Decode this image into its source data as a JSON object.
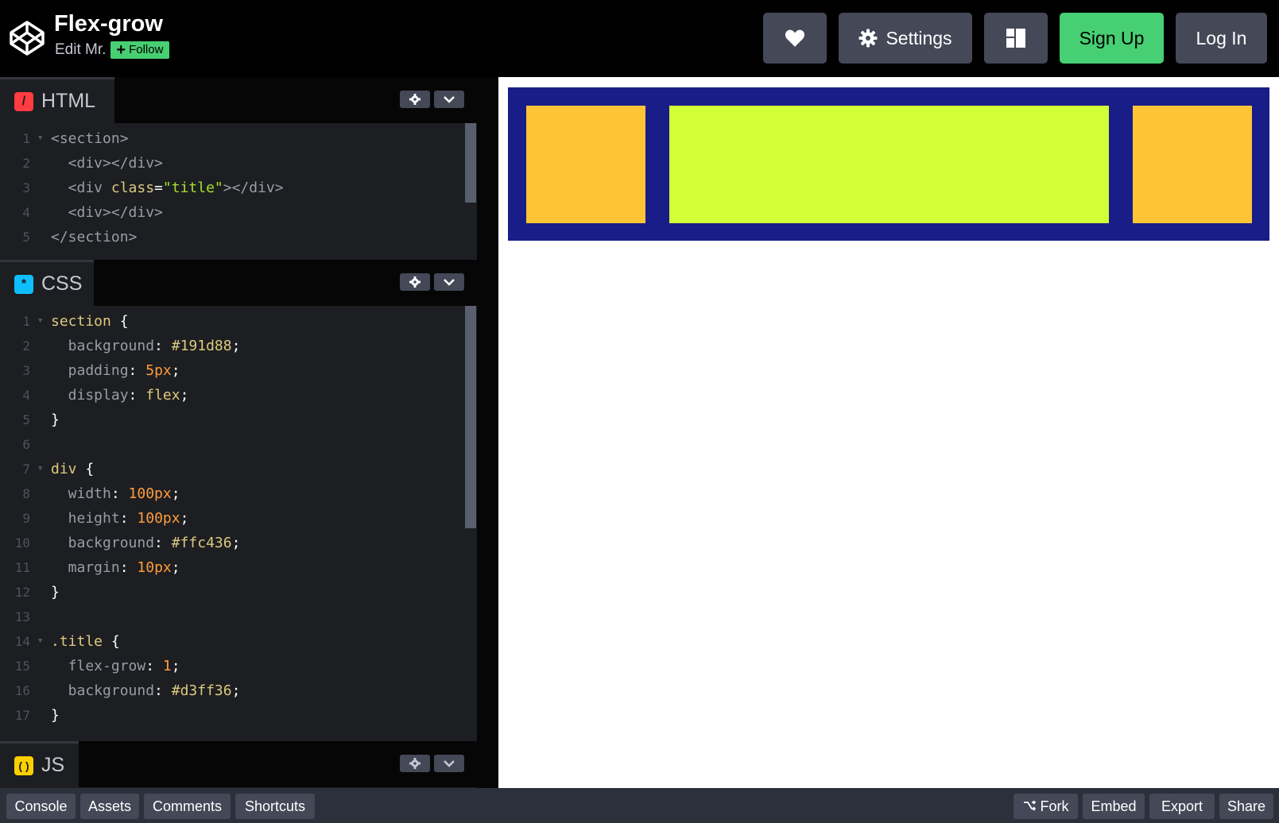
{
  "header": {
    "logo_icon": "codepen-logo-icon",
    "title": "Flex-grow",
    "author_prefix": "Edit Mr.",
    "follow_label": "Follow",
    "buttons": {
      "heart_icon": "heart-icon",
      "settings_label": "Settings",
      "settings_icon": "gear-icon",
      "layout_icon": "layout-icon",
      "signup_label": "Sign Up",
      "login_label": "Log In"
    }
  },
  "editors": {
    "html": {
      "label": "HTML",
      "icon_color": "#ff3c41",
      "lines": [
        {
          "n": "1"
        },
        {
          "n": "2"
        },
        {
          "n": "3"
        },
        {
          "n": "4"
        },
        {
          "n": "5"
        }
      ]
    },
    "css": {
      "label": "CSS",
      "icon_color": "#0ebeff",
      "lines": [
        {
          "n": "1"
        },
        {
          "n": "2"
        },
        {
          "n": "3"
        },
        {
          "n": "4"
        },
        {
          "n": "5"
        },
        {
          "n": "6"
        },
        {
          "n": "7"
        },
        {
          "n": "8"
        },
        {
          "n": "9"
        },
        {
          "n": "10"
        },
        {
          "n": "11"
        },
        {
          "n": "12"
        },
        {
          "n": "13"
        },
        {
          "n": "14"
        },
        {
          "n": "15"
        },
        {
          "n": "16"
        },
        {
          "n": "17"
        }
      ]
    },
    "js": {
      "label": "JS",
      "icon_color": "#fcd000"
    }
  },
  "code": {
    "html": {
      "l1": "<section>",
      "l2": "  <div></div>",
      "l3_a": "  <div ",
      "l3_attr": "class",
      "l3_eq": "=",
      "l3_str": "\"title\"",
      "l3_b": "></div>",
      "l4": "  <div></div>",
      "l5": "</section>"
    },
    "css": {
      "l1_sel": "section",
      "l1_p": " {",
      "l2_prop": "  background",
      "l2_val": "#191d88",
      "l3_prop": "  padding",
      "l3_val": "5px",
      "l4_prop": "  display",
      "l4_val": "flex",
      "l5": "}",
      "l7_sel": "div",
      "l7_p": " {",
      "l8_prop": "  width",
      "l8_val": "100px",
      "l9_prop": "  height",
      "l9_val": "100px",
      "l10_prop": "  background",
      "l10_val": "#ffc436",
      "l11_prop": "  margin",
      "l11_val": "10px",
      "l12": "}",
      "l14_sel": ".title",
      "l14_p": " {",
      "l15_prop": "  flex-grow",
      "l15_val": "1",
      "l16_prop": "  background",
      "l16_val": "#d3ff36",
      "l17": "}",
      "colon": ": ",
      "semi": ";"
    }
  },
  "preview": {
    "section_color": "#191d88",
    "box_color": "#ffc436",
    "title_color": "#d3ff36"
  },
  "footer": {
    "left": [
      "Console",
      "Assets",
      "Comments",
      "Shortcuts"
    ],
    "fork_label": "Fork",
    "fork_icon": "fork-icon",
    "embed_label": "Embed",
    "export_label": "Export",
    "share_label": "Share"
  }
}
